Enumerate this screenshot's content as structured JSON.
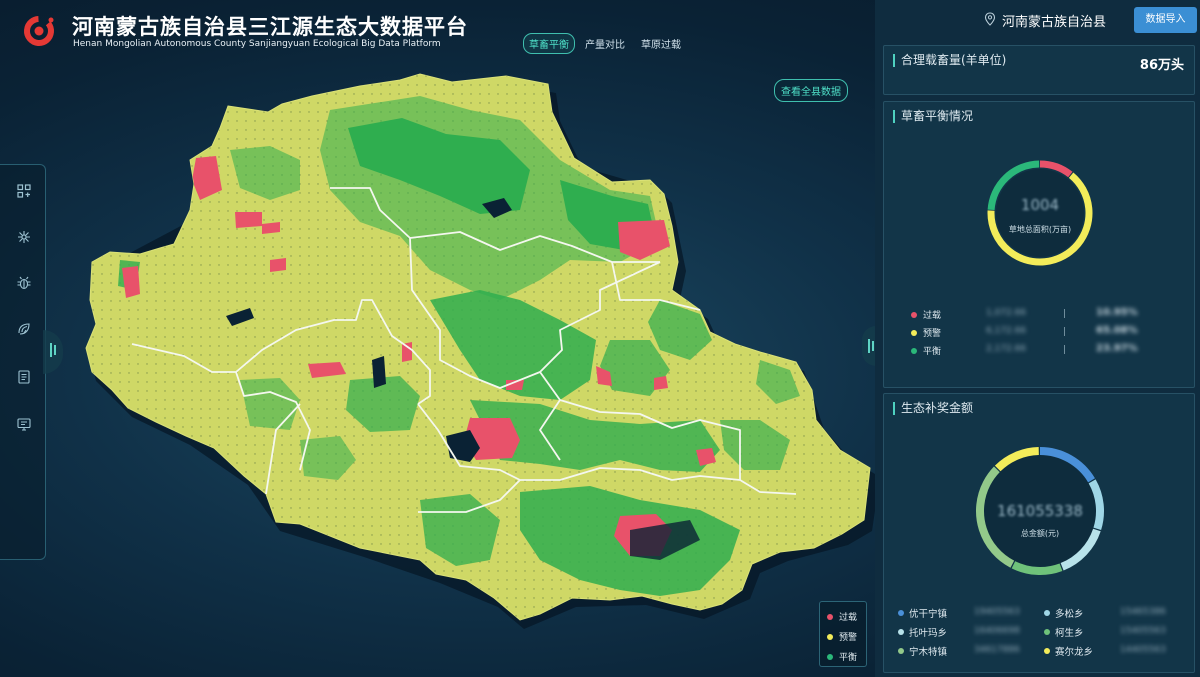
{
  "header": {
    "title_cn": "河南蒙古族自治县三江源生态大数据平台",
    "title_en": "Henan Mongolian Autonomous County Sanjiangyuan Ecological Big Data Platform",
    "tabs": [
      {
        "label": "草畜平衡",
        "active": true
      },
      {
        "label": "产量对比",
        "active": false
      },
      {
        "label": "草原过载",
        "active": false
      }
    ],
    "view_all_label": "查看全县数据"
  },
  "toolbar": {
    "region": "河南蒙古族自治县",
    "import_label": "数据导入",
    "left_icons": [
      "grid-icon",
      "network-icon",
      "bug-icon",
      "leaf-fingerprint-icon",
      "document-icon",
      "monitor-icon"
    ]
  },
  "map_legend": {
    "items": [
      {
        "label": "过载",
        "color": "#e8526a"
      },
      {
        "label": "预警",
        "color": "#f3ec5a"
      },
      {
        "label": "平衡",
        "color": "#2bb87a"
      }
    ]
  },
  "capacity": {
    "title": "合理载畜量(羊单位)",
    "value": "86万头"
  },
  "balance": {
    "title": "草畜平衡情况",
    "center_value": "1004",
    "center_caption": "草地总面积(万亩)",
    "rows": [
      {
        "label": "过载",
        "color": "#e8526a",
        "value": "1,072.66",
        "percent": "10.95%",
        "share": 0.1095
      },
      {
        "label": "预警",
        "color": "#f3ec5a",
        "value": "6,172.66",
        "percent": "65.08%",
        "share": 0.6508
      },
      {
        "label": "平衡",
        "color": "#2bb87a",
        "value": "2,172.66",
        "percent": "23.97%",
        "share": 0.2397
      }
    ]
  },
  "compensation": {
    "title": "生态补奖金额",
    "center_value": "161055338",
    "center_caption": "总金额(元)",
    "towns": [
      {
        "label": "优干宁镇",
        "color": "#4a90d9",
        "value": "19405563"
      },
      {
        "label": "多松乡",
        "color": "#9fd6e6",
        "value": "15465386"
      },
      {
        "label": "托叶玛乡",
        "color": "#b8e2ea",
        "value": "16406698"
      },
      {
        "label": "柯生乡",
        "color": "#6fc27a",
        "value": "15405563"
      },
      {
        "label": "宁木特镇",
        "color": "#93c98a",
        "value": "34617886"
      },
      {
        "label": "赛尔龙乡",
        "color": "#f3ec5a",
        "value": "14405563"
      }
    ]
  }
}
